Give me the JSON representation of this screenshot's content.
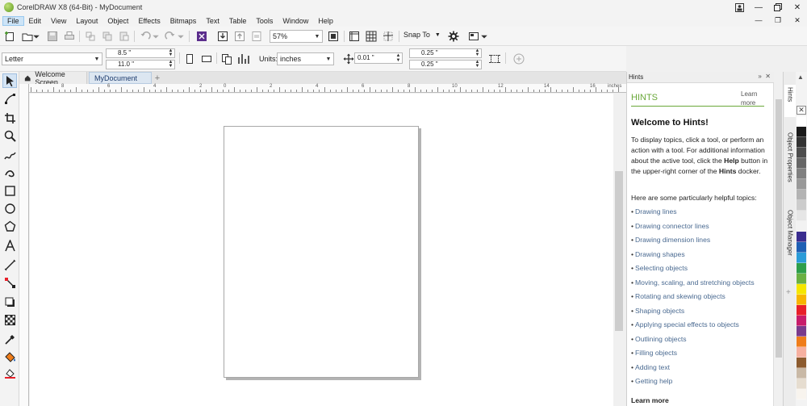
{
  "window": {
    "title": "CorelDRAW X8 (64-Bit) - MyDocument"
  },
  "menu": [
    "File",
    "Edit",
    "View",
    "Layout",
    "Object",
    "Effects",
    "Bitmaps",
    "Text",
    "Table",
    "Tools",
    "Window",
    "Help"
  ],
  "standard_toolbar": {
    "zoom_value": "57%",
    "snap_label": "Snap To"
  },
  "property_bar": {
    "page_size": "Letter",
    "width": "8.5 \"",
    "height": "11.0 \"",
    "units_label": "Units:",
    "units_value": "inches",
    "nudge": "0.01 \"",
    "dup_x": "0.25 \"",
    "dup_y": "0.25 \""
  },
  "doc_tabs": {
    "home": "Welcome Screen",
    "current": "MyDocument"
  },
  "ruler": {
    "unit": "inches",
    "ticks": [
      "8",
      "6",
      "4",
      "2",
      "0",
      "2",
      "4",
      "6",
      "8",
      "10",
      "12",
      "14",
      "16"
    ]
  },
  "hints": {
    "panel_title": "Hints",
    "heading": "HINTS",
    "learn_more_top": "Learn more",
    "welcome": "Welcome to Hints!",
    "intro_1": "To display topics, click a tool, or perform an action with a tool. For additional information about the active tool, click the ",
    "intro_help": "Help",
    "intro_2": " button in the upper-right corner of the ",
    "intro_hints": "Hints",
    "intro_3": " docker.",
    "topics_intro": "Here are some particularly helpful topics:",
    "topics": [
      "Drawing lines",
      "Drawing connector lines",
      "Drawing dimension lines",
      "Drawing shapes",
      "Selecting objects",
      "Moving, scaling, and stretching objects",
      "Rotating and skewing objects",
      "Shaping objects",
      "Applying special effects to objects",
      "Outlining objects",
      "Filling objects",
      "Adding text",
      "Getting help"
    ],
    "learn_more_bottom": "Learn more"
  },
  "docker_tabs": [
    "Hints",
    "Object Properties",
    "Object Manager"
  ],
  "palette": [
    "#ffffff",
    "#1a1a1a",
    "#333333",
    "#4d4d4d",
    "#666666",
    "#808080",
    "#999999",
    "#b3b3b3",
    "#cccccc",
    "#e6e6e6",
    "#f2f2f2",
    "#3a2d8f",
    "#1e5fb4",
    "#2b9cd8",
    "#2e9e4a",
    "#6ab043",
    "#f5e600",
    "#f7b500",
    "#e8202a",
    "#c81d6b",
    "#7a3b8c",
    "#ef7d1a",
    "#f6b0a0",
    "#8c5b2e",
    "#c9b9a6",
    "#e6ddd0",
    "#f8f4ee"
  ],
  "theme": {
    "accent": "#6aa83a",
    "link": "#4a6a91",
    "selection": "#cde4f7"
  }
}
